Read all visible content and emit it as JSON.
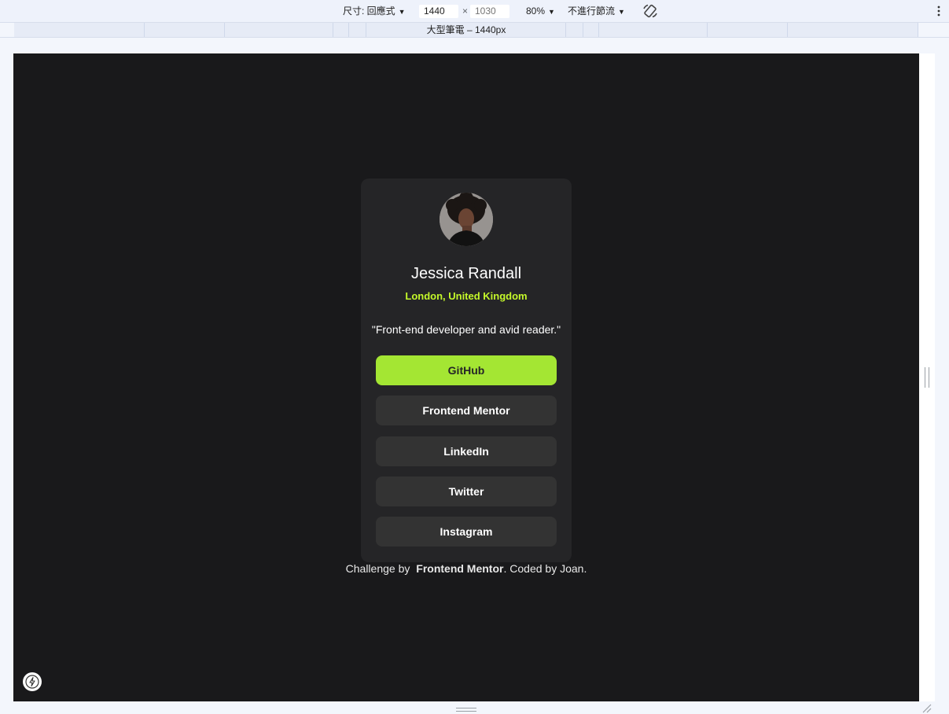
{
  "devtools": {
    "dimensions_label": "尺寸: 回應式",
    "width_value": "1440",
    "height_placeholder": "1030",
    "separator": "×",
    "zoom": "80%",
    "throttle": "不進行節流",
    "media_label": "大型筆電 – 1440px"
  },
  "profile": {
    "name": "Jessica Randall",
    "location": "London, United Kingdom",
    "bio": "\"Front-end developer and avid reader.\"",
    "links": [
      "GitHub",
      "Frontend Mentor",
      "LinkedIn",
      "Twitter",
      "Instagram"
    ]
  },
  "footer": {
    "prefix": "Challenge by ",
    "link": "Frontend Mentor",
    "suffix": ". Coded by Joan."
  },
  "colors": {
    "page_bg": "#19191b",
    "card_bg": "#252527",
    "accent_green": "#c4f82a",
    "button_active": "#a4e633",
    "button_bg": "#333333"
  },
  "icons": {
    "dropdown": "triangle-down-icon",
    "rotate": "rotate-icon",
    "menu": "kebab-menu-icon",
    "bolt": "lightning-icon"
  }
}
